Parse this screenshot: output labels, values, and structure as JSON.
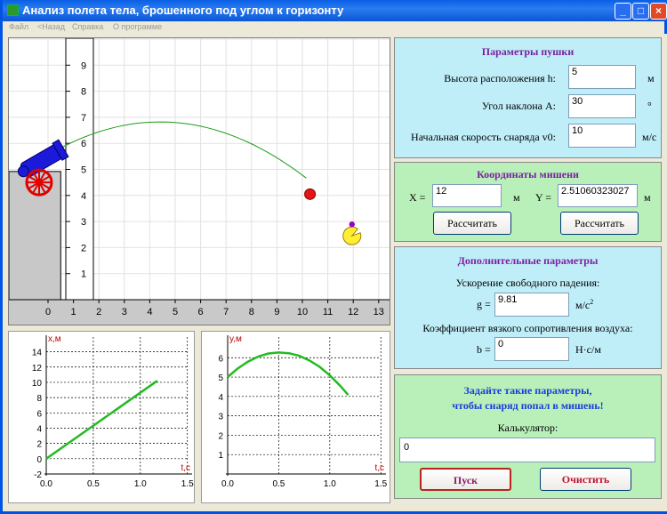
{
  "window": {
    "title": "Анализ полета тела, брошенного под углом к горизонту",
    "btn_min": "_",
    "btn_max": "□",
    "btn_close": "×"
  },
  "menu": [
    "Файл",
    "<Назад",
    "Справка",
    "О программе"
  ],
  "sim": {
    "x_ticks": [
      "0",
      "1",
      "2",
      "3",
      "4",
      "5",
      "6",
      "7",
      "8",
      "9",
      "10",
      "11",
      "12",
      "13"
    ],
    "y_ticks": [
      "1",
      "2",
      "3",
      "4",
      "5",
      "6",
      "7",
      "8",
      "9"
    ],
    "x_range": [
      -1.5,
      13.5
    ],
    "y_range": [
      0,
      10
    ]
  },
  "graph_x": {
    "ylabel": "x,м",
    "xlabel": "t,c",
    "x_ticks": [
      "0.0",
      "0.5",
      "1.0",
      "1.5"
    ],
    "y_ticks": [
      "-2",
      "0",
      "2",
      "4",
      "6",
      "8",
      "10",
      "12",
      "14"
    ]
  },
  "graph_y": {
    "ylabel": "y,м",
    "xlabel": "t,c",
    "x_ticks": [
      "0.0",
      "0.5",
      "1.0",
      "1.5"
    ],
    "y_ticks": [
      "1",
      "2",
      "3",
      "4",
      "5",
      "6"
    ]
  },
  "cannon_params": {
    "title": "Параметры пушки",
    "height_label": "Высота расположения h:",
    "height_value": "5",
    "height_unit": "м",
    "angle_label": "Угол наклона A:",
    "angle_value": "30",
    "angle_unit": "°",
    "speed_label": "Начальная скорость снаряда v0:",
    "speed_value": "10",
    "speed_unit": "м/с"
  },
  "target": {
    "title": "Координаты мишени",
    "x_label": "X =",
    "x_value": "12",
    "x_unit": "м",
    "y_label": "Y =",
    "y_value": "2.51060323027",
    "y_unit": "м",
    "calc_x_button": "Рассчитать",
    "calc_y_button": "Рассчитать"
  },
  "extra": {
    "title": "Дополнительные параметры",
    "g_caption": "Ускорение свободного падения:",
    "g_label": "g =",
    "g_value": "9.81",
    "g_unit": "м/с",
    "g_unit_sup": "2",
    "b_caption": "Коэффициент вязкого сопротивления воздуха:",
    "b_label": "b =",
    "b_value": "0",
    "b_unit": "Н·с/м"
  },
  "control": {
    "hint_line1": "Задайте такие параметры,",
    "hint_line2": "чтобы снаряд попал в мишень!",
    "calc_label": "Калькулятор:",
    "calc_value": "0",
    "start_button": "Пуск",
    "clear_button": "Очистить"
  },
  "chart_data": [
    {
      "type": "line",
      "xlabel": "t,c",
      "ylabel": "x,м",
      "xlim": [
        0,
        1.55
      ],
      "ylim": [
        -2,
        15
      ],
      "series": [
        {
          "x": [
            0.0,
            1.18
          ],
          "y": [
            0.0,
            10.2
          ]
        }
      ]
    },
    {
      "type": "line",
      "xlabel": "t,c",
      "ylabel": "y,м",
      "xlim": [
        0,
        1.55
      ],
      "ylim": [
        0,
        6.7
      ],
      "series": [
        {
          "x": [
            0.0,
            0.1,
            0.2,
            0.3,
            0.4,
            0.5,
            0.6,
            0.7,
            0.8,
            0.9,
            1.0,
            1.1,
            1.18
          ],
          "y": [
            5.0,
            5.45,
            5.8,
            6.06,
            6.22,
            6.27,
            6.23,
            6.1,
            5.86,
            5.53,
            5.09,
            4.56,
            4.08
          ]
        }
      ]
    }
  ]
}
